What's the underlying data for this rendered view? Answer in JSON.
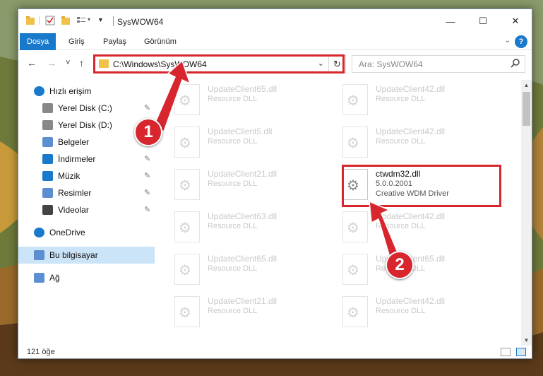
{
  "window": {
    "title": "SysWOW64",
    "minimize": "—",
    "maximize": "☐",
    "close": "✕"
  },
  "ribbon": {
    "tabs": [
      "Dosya",
      "Giriş",
      "Paylaş",
      "Görünüm"
    ],
    "expand": "⌄",
    "help": "?"
  },
  "nav": {
    "back": "←",
    "forward": "→",
    "recent": "˅",
    "up": "↑",
    "address": "C:\\Windows\\SysWOW64",
    "address_dropdown": "⌄",
    "refresh": "↻",
    "search_placeholder": "Ara: SysWOW64"
  },
  "sidebar": {
    "items": [
      {
        "label": "Hızlı erişim",
        "icon": "star-icon"
      },
      {
        "label": "Yerel Disk (C:)",
        "icon": "drive-icon",
        "pinned": true
      },
      {
        "label": "Yerel Disk (D:)",
        "icon": "drive-icon"
      },
      {
        "label": "Belgeler",
        "icon": "documents-icon"
      },
      {
        "label": "İndirmeler",
        "icon": "download-icon",
        "pinned": true
      },
      {
        "label": "Müzik",
        "icon": "music-icon",
        "pinned": true
      },
      {
        "label": "Resimler",
        "icon": "pictures-icon",
        "pinned": true
      },
      {
        "label": "Videolar",
        "icon": "video-icon",
        "pinned": true
      },
      {
        "label": "OneDrive",
        "icon": "cloud-icon"
      },
      {
        "label": "Bu bilgisayar",
        "icon": "computer-icon",
        "selected": true
      },
      {
        "label": "Ağ",
        "icon": "network-icon"
      }
    ],
    "pin_glyph": "📌"
  },
  "files": [
    {
      "name": "UpdateClient65.dll",
      "desc": "Resource DLL",
      "col": 0,
      "row": 0
    },
    {
      "name": "UpdateClient42.dll",
      "desc": "Resource DLL",
      "col": 1,
      "row": 0
    },
    {
      "name": "UpdateClient5.dll",
      "desc": "Resource DLL",
      "col": 0,
      "row": 1
    },
    {
      "name": "UpdateClient42.dll",
      "desc": "Resource DLL",
      "col": 1,
      "row": 1
    },
    {
      "name": "UpdateClient21.dll",
      "desc": "Resource DLL",
      "col": 0,
      "row": 2
    },
    {
      "name": "ctwdm32.dll",
      "desc": "5.0.0.2001",
      "desc2": "Creative WDM Driver",
      "col": 1,
      "row": 2,
      "active": true
    },
    {
      "name": "UpdateClient63.dll",
      "desc": "Resource DLL",
      "col": 0,
      "row": 3
    },
    {
      "name": "UpdateClient42.dll",
      "desc": "Resource DLL",
      "col": 1,
      "row": 3
    },
    {
      "name": "UpdateClient65.dll",
      "desc": "Resource DLL",
      "col": 0,
      "row": 4
    },
    {
      "name": "UpdateClient65.dll",
      "desc": "Resource DLL",
      "col": 1,
      "row": 4
    },
    {
      "name": "UpdateClient21.dll",
      "desc": "Resource DLL",
      "col": 0,
      "row": 5
    },
    {
      "name": "UpdateClient42.dll",
      "desc": "Resource DLL",
      "col": 1,
      "row": 5
    }
  ],
  "status": {
    "count": "121 öğe"
  },
  "scroll": {
    "up": "▲",
    "down": "▼"
  },
  "callouts": [
    {
      "number": "1"
    },
    {
      "number": "2"
    }
  ],
  "colors": {
    "accent": "#1979ca",
    "highlight": "#d7262d",
    "selected": "#cce4f7"
  }
}
